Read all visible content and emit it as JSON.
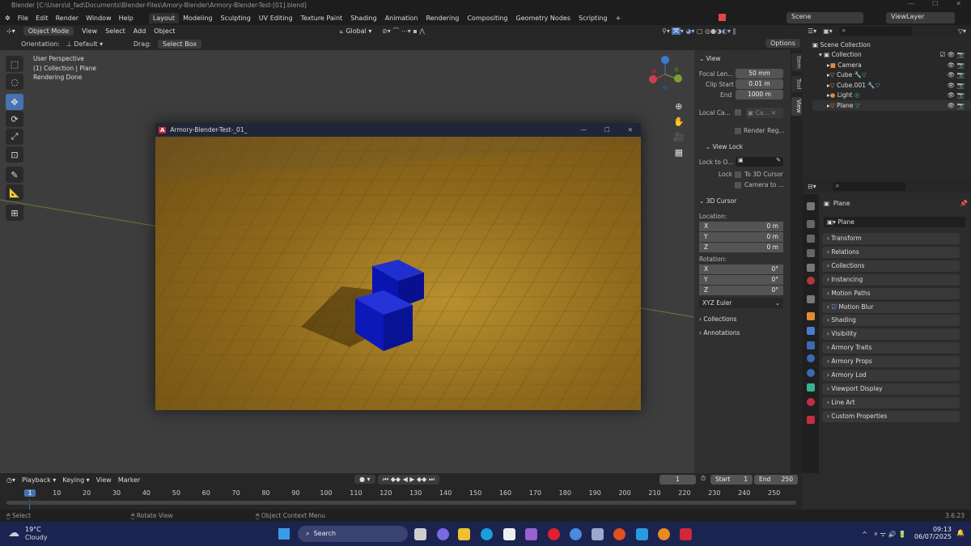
{
  "window": {
    "title": "Blender [C:\\Users\\d_fad\\Documents\\Blender-Files\\Amory-Blender\\Armory-Blender-Test-[01].blend]"
  },
  "menu": [
    "File",
    "Edit",
    "Render",
    "Window",
    "Help"
  ],
  "workspaces": [
    "Layout",
    "Modeling",
    "Sculpting",
    "UV Editing",
    "Texture Paint",
    "Shading",
    "Animation",
    "Rendering",
    "Compositing",
    "Geometry Nodes",
    "Scripting",
    "+"
  ],
  "scene": {
    "name": "Scene",
    "view_layer": "ViewLayer"
  },
  "viewport_header": {
    "mode": "Object Mode",
    "items": [
      "View",
      "Select",
      "Add",
      "Object"
    ],
    "transform": "Global",
    "options": "Options"
  },
  "tool_settings": {
    "orientation_label": "Orientation:",
    "orientation": "Default",
    "drag_label": "Drag:",
    "drag": "Select Box"
  },
  "viewport_info": [
    "User Perspective",
    "(1) Collection | Plane",
    "Rendering Done"
  ],
  "npanel": {
    "tabs": [
      "Item",
      "Tool",
      "View"
    ],
    "view_header": "View",
    "focal_label": "Focal Len...",
    "focal": "50 mm",
    "clip_start_label": "Clip Start",
    "clip_start": "0.01 m",
    "end_label": "End",
    "end": "1000 m",
    "local_cam_label": "Local Ca...",
    "local_cam": "Ca...",
    "render_region": "Render Reg...",
    "view_lock": "View Lock",
    "lock_to": "Lock to O...",
    "lock_label": "Lock",
    "to_cursor": "To 3D Cursor",
    "camera_to": "Camera to ...",
    "cursor_header": "3D Cursor",
    "location": "Location:",
    "rotation": "Rotation:",
    "loc": [
      [
        "X",
        "0 m"
      ],
      [
        "Y",
        "0 m"
      ],
      [
        "Z",
        "0 m"
      ]
    ],
    "rot": [
      [
        "X",
        "0°"
      ],
      [
        "Y",
        "0°"
      ],
      [
        "Z",
        "0°"
      ]
    ],
    "rot_mode": "XYZ Euler",
    "collections": "Collections",
    "annotations": "Annotations"
  },
  "outliner": {
    "root": "Scene Collection",
    "collection": "Collection",
    "items": [
      "Camera",
      "Cube",
      "Cube.001",
      "Light",
      "Plane"
    ]
  },
  "properties": {
    "object": "Plane",
    "data_name": "Plane",
    "sections": [
      "Transform",
      "Relations",
      "Collections",
      "Instancing",
      "Motion Paths",
      "Motion Blur",
      "Shading",
      "Visibility",
      "Armory Traits",
      "Armory Props",
      "Armory Lod",
      "Viewport Display",
      "Line Art",
      "Custom Properties"
    ]
  },
  "game_window": {
    "title": "Armory-Blender-Test-_01_"
  },
  "timeline": {
    "menus": [
      "Playback",
      "Keying",
      "View",
      "Marker"
    ],
    "current_frame": "1",
    "start_label": "Start",
    "start": "1",
    "end_label": "End",
    "end": "250",
    "ticks": [
      "1",
      "10",
      "20",
      "30",
      "40",
      "50",
      "60",
      "70",
      "80",
      "90",
      "100",
      "110",
      "120",
      "130",
      "140",
      "150",
      "160",
      "170",
      "180",
      "190",
      "200",
      "210",
      "220",
      "230",
      "240",
      "250"
    ]
  },
  "statusbar": {
    "select": "Select",
    "rotate": "Rotate View",
    "context": "Object Context Menu",
    "version": "3.6.23"
  },
  "taskbar": {
    "temp": "19°C",
    "weather": "Cloudy",
    "search": "Search",
    "time": "09:13",
    "date": "06/07/2025"
  },
  "colors": {
    "accent": "#4772b3",
    "cube": "#0a14b4",
    "floor": "#a07a22",
    "armory": "#d0283a"
  }
}
